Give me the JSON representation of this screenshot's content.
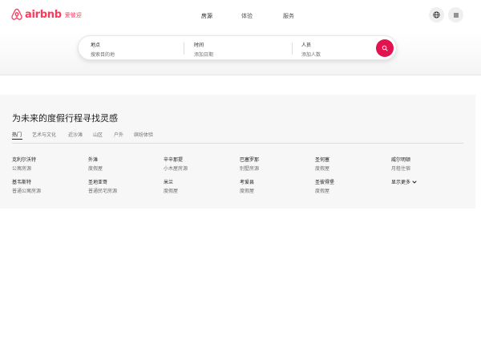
{
  "logo": {
    "text": "airbnb",
    "subtext": "爱彼迎",
    "color": "#ff385c"
  },
  "nav": {
    "items": [
      {
        "label": "房源",
        "active": true
      },
      {
        "label": "体验",
        "active": false
      },
      {
        "label": "服务",
        "active": false
      }
    ]
  },
  "header_icons": {
    "language": "globe-icon",
    "menu": "menu-icon"
  },
  "search": {
    "where_label": "地点",
    "where_placeholder": "搜索目的地",
    "when_label": "时间",
    "when_placeholder": "添加日期",
    "who_label": "人员",
    "who_placeholder": "添加人数",
    "button_color": "#e0154f"
  },
  "inspiration": {
    "title": "为未来的度假行程寻找灵感",
    "tabs": [
      "热门",
      "艺术与文化",
      "近沙滩",
      "山区",
      "户外",
      "缤纷体验"
    ],
    "active_tab": "热门",
    "destinations": [
      {
        "name": "克利尔沃特",
        "type": "公寓房源"
      },
      {
        "name": "外滩",
        "type": "度假屋"
      },
      {
        "name": "辛辛那提",
        "type": "小木屋房源"
      },
      {
        "name": "巴塞罗那",
        "type": "别墅房源"
      },
      {
        "name": "圣何塞",
        "type": "度假屋"
      },
      {
        "name": "威尔明顿",
        "type": "月租住宿"
      },
      {
        "name": "基韦斯特",
        "type": "普通公寓房源"
      },
      {
        "name": "圣地亚哥",
        "type": "普通民宅房源"
      },
      {
        "name": "米兰",
        "type": "度假屋"
      },
      {
        "name": "考爱县",
        "type": "度假屋"
      },
      {
        "name": "圣彼得堡",
        "type": "度假屋"
      }
    ],
    "show_more": "显示更多"
  }
}
